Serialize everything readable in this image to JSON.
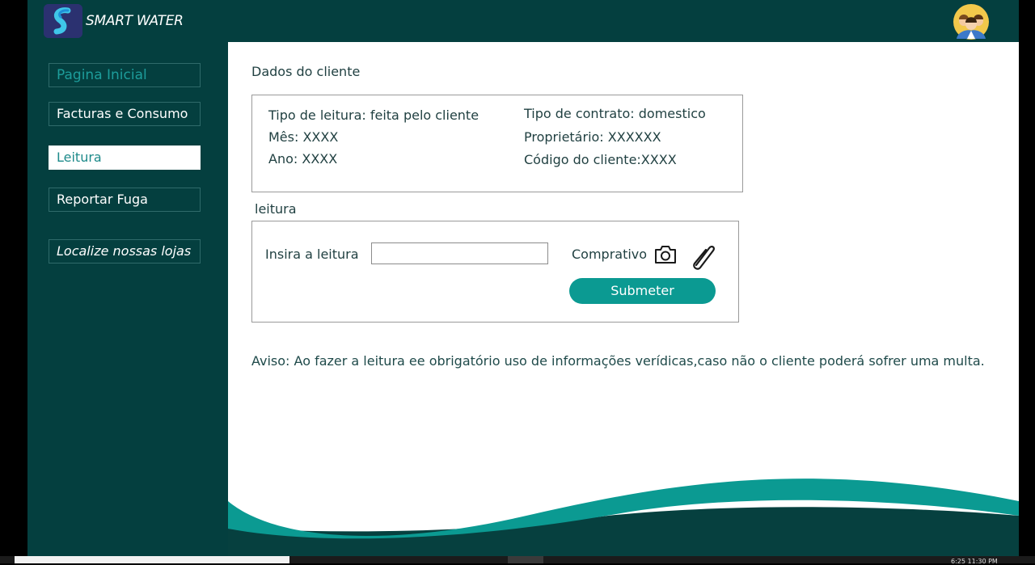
{
  "app": {
    "title": "SMART WATER"
  },
  "sidebar": {
    "items": [
      {
        "label": "Pagina Inicial"
      },
      {
        "label": "Facturas e Consumo"
      },
      {
        "label": "Leitura"
      },
      {
        "label": "Reportar Fuga"
      },
      {
        "label": "Localize nossas lojas"
      }
    ],
    "active": "Leitura"
  },
  "client": {
    "heading": "Dados do cliente",
    "tipo_leitura": "Tipo de leitura: feita  pelo cliente",
    "mes": "Mês: XXXX",
    "ano": "Ano: XXXX",
    "tipo_contrato": "Tipo de contrato: domestico",
    "proprietario": "Proprietário: XXXXXX",
    "codigo": "Código do cliente:XXXX"
  },
  "reading": {
    "heading": "leitura",
    "label": "Insira a leitura",
    "value": "",
    "proof_label": "Comprativo",
    "submit_label": "Submeter"
  },
  "notice": "Aviso: Ao fazer a leitura ee obrigatório uso de informações verídicas,caso não o cliente poderá sofrer uma multa.",
  "icons": {
    "camera": "camera-icon",
    "attach": "paperclip-icon",
    "logo": "smart-water-logo",
    "avatar": "user-avatar"
  },
  "colors": {
    "primary": "#043f3f",
    "accent": "#0b9a92",
    "link": "#1d9d9b"
  },
  "taskbar": {
    "clock": "6:25    11:30 PM"
  }
}
